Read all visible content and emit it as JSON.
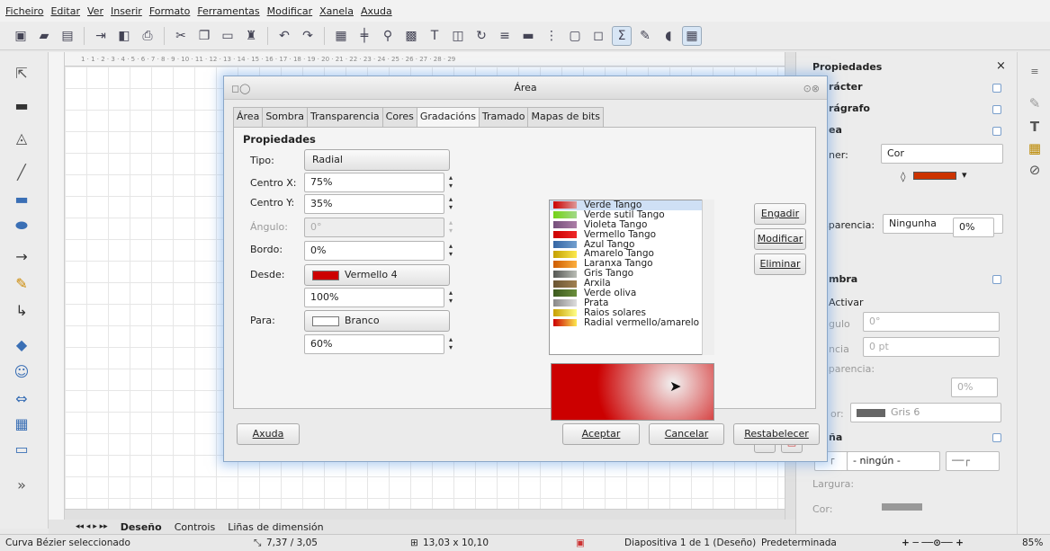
{
  "menu": [
    "Ficheiro",
    "Editar",
    "Ver",
    "Inserir",
    "Formato",
    "Ferramentas",
    "Modificar",
    "Xanela",
    "Axuda"
  ],
  "ruler_text": "1 · 1 · 2 · 3 · 4 · 5 · 6 · 7 · 8 · 9 · 10 · 11 · 12 · 13 · 14 · 15 · 16 · 17 · 18 · 19 · 20 · 21 · 22 · 23 · 24 · 25 · 26 · 27 · 28 · 29",
  "tabs": {
    "deseno": "Deseño",
    "controis": "Controis",
    "linas": "Liñas de dimensión"
  },
  "status": {
    "object": "Curva Bézier seleccionado",
    "pos": "7,37 / 3,05",
    "size": "13,03 x 10,10",
    "slide": "Diapositiva 1 de 1 (Deseño)",
    "layout": "Predeterminada",
    "zoom": "85%"
  },
  "sidebar": {
    "title": "Propiedades",
    "caracter": "rácter",
    "paragrafo": "rágrafo",
    "area": "ea",
    "encher_label": "ner:",
    "encher_value": "Cor",
    "transp_label": "sparencia:",
    "transp_value": "Ningunha",
    "transp_pct": "0%",
    "sombra": "mbra",
    "activar": "Activar",
    "angulo_label": "gulo",
    "angulo_value": "0°",
    "distancia_label": "ncia",
    "distancia_value": "0 pt",
    "transp2_label": "sparencia:",
    "transp2_pct": "0%",
    "cor_label": "or:",
    "cor_value": "Gris 6",
    "lina": "ña",
    "ningun": "- ningún -",
    "largura": "Largura:",
    "cor2": "Cor:"
  },
  "dialog": {
    "title": "Área",
    "tabs": [
      "Área",
      "Sombra",
      "Transparencia",
      "Cores",
      "Gradacións",
      "Tramado",
      "Mapas de bits"
    ],
    "section": "Propiedades",
    "tipo_label": "Tipo:",
    "tipo_value": "Radial",
    "cx_label": "Centro X:",
    "cx_value": "75%",
    "cy_label": "Centro Y:",
    "cy_value": "35%",
    "ang_label": "Ángulo:",
    "ang_value": "0°",
    "bordo_label": "Bordo:",
    "bordo_value": "0%",
    "desde_label": "Desde:",
    "desde_value": "Vermello 4",
    "desde_pct": "100%",
    "para_label": "Para:",
    "para_value": "Branco",
    "para_pct": "60%",
    "gradients": [
      {
        "name": "Verde Tango",
        "c1": "#cc0000",
        "c2": "#d99"
      },
      {
        "name": "Verde sutil Tango",
        "c1": "#73d216",
        "c2": "#a3d98a"
      },
      {
        "name": "Violeta Tango",
        "c1": "#75507b",
        "c2": "#ad7fa8"
      },
      {
        "name": "Vermello Tango",
        "c1": "#cc0000",
        "c2": "#ef2929"
      },
      {
        "name": "Azul Tango",
        "c1": "#3465a4",
        "c2": "#729fcf"
      },
      {
        "name": "Amarelo Tango",
        "c1": "#c4a000",
        "c2": "#fce94f"
      },
      {
        "name": "Laranxa Tango",
        "c1": "#ce5c00",
        "c2": "#fcaf3e"
      },
      {
        "name": "Gris Tango",
        "c1": "#555753",
        "c2": "#babdb6"
      },
      {
        "name": "Arxila",
        "c1": "#6a5533",
        "c2": "#a08050"
      },
      {
        "name": "Verde oliva",
        "c1": "#3c5a1e",
        "c2": "#6b8e3c"
      },
      {
        "name": "Prata",
        "c1": "#888",
        "c2": "#ddd"
      },
      {
        "name": "Raios solares",
        "c1": "#c8a000",
        "c2": "#ff8"
      },
      {
        "name": "Radial vermello/amarelo",
        "c1": "#cc0000",
        "c2": "#fce94f"
      }
    ],
    "engadir": "Engadir",
    "modificar": "Modificar",
    "eliminar": "Eliminar",
    "axuda": "Axuda",
    "aceptar": "Aceptar",
    "cancelar": "Cancelar",
    "restabelecer": "Restabelecer"
  }
}
